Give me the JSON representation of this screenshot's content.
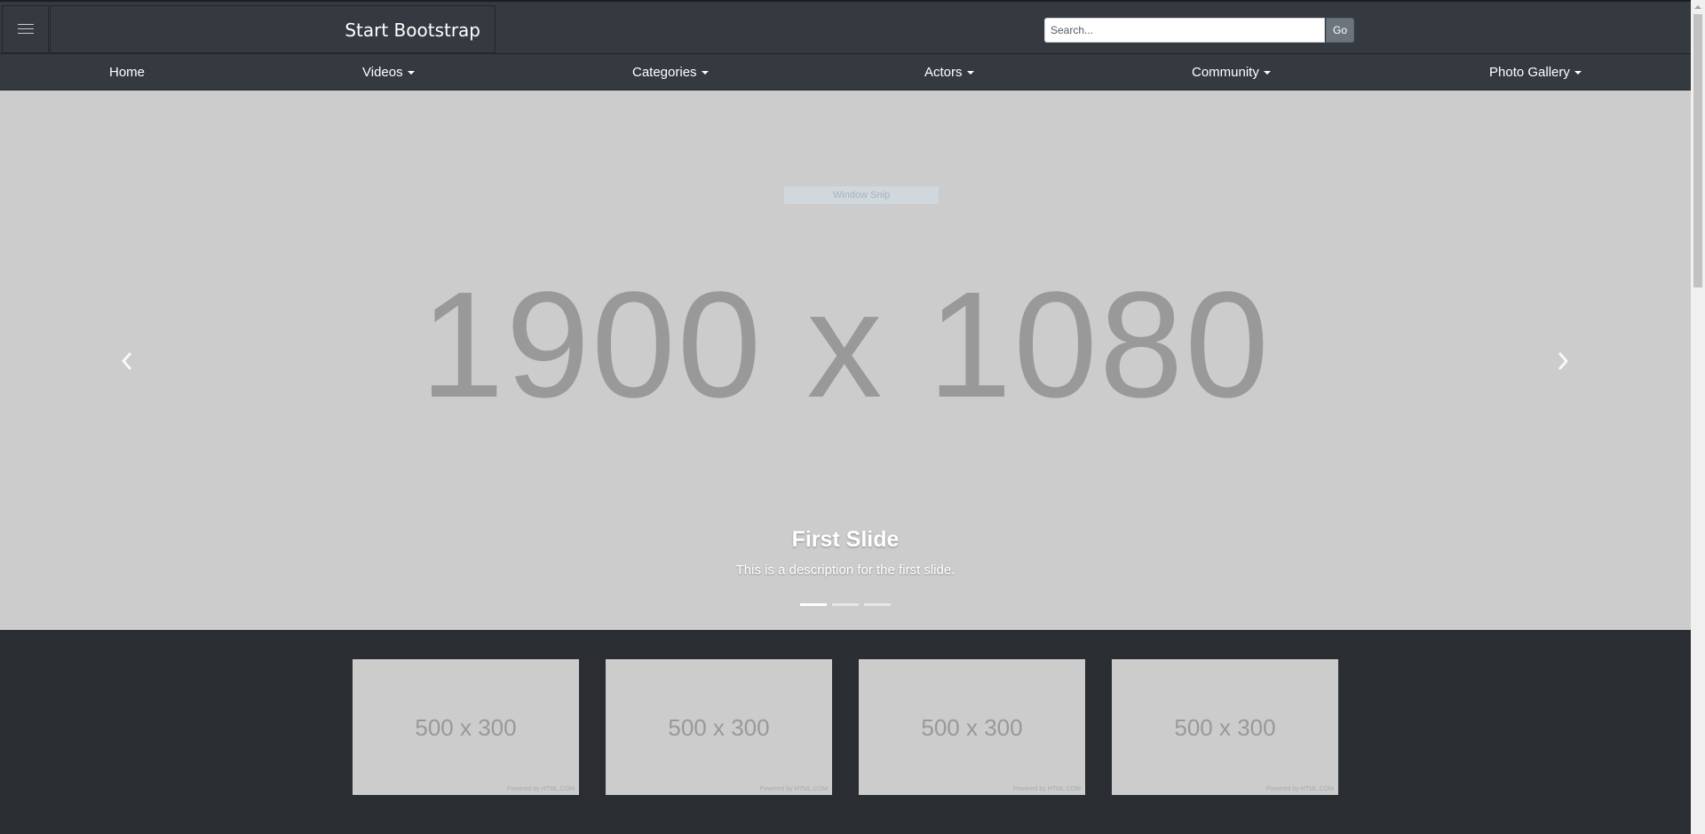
{
  "navbar": {
    "brand": "Start Bootstrap",
    "search_placeholder": "Search...",
    "go_label": "Go",
    "toggler_icon": "hamburger-icon"
  },
  "mainnav": {
    "items": [
      {
        "label": "Home",
        "dropdown": false
      },
      {
        "label": "Videos",
        "dropdown": true
      },
      {
        "label": "Categories",
        "dropdown": true
      },
      {
        "label": "Actors",
        "dropdown": true
      },
      {
        "label": "Community",
        "dropdown": true
      },
      {
        "label": "Photo Gallery",
        "dropdown": true
      }
    ]
  },
  "carousel": {
    "placeholder_text": "1900 x 1080",
    "overlay_text": "Window Snip",
    "caption_title": "First Slide",
    "caption_description": "This is a description for the first slide.",
    "indicator_count": 3,
    "active_indicator": 0,
    "prev_icon": "chevron-left-icon",
    "next_icon": "chevron-right-icon"
  },
  "thumbnails": [
    {
      "label": "500 x 300",
      "credit": "Powered by HTML.COM"
    },
    {
      "label": "500 x 300",
      "credit": "Powered by HTML.COM"
    },
    {
      "label": "500 x 300",
      "credit": "Powered by HTML.COM"
    },
    {
      "label": "500 x 300",
      "credit": "Powered by HTML.COM"
    }
  ],
  "colors": {
    "navbar_bg": "#353a40",
    "carousel_bg": "#cccccc",
    "page_bg": "#2a2d31",
    "go_button": "#6c757d"
  }
}
